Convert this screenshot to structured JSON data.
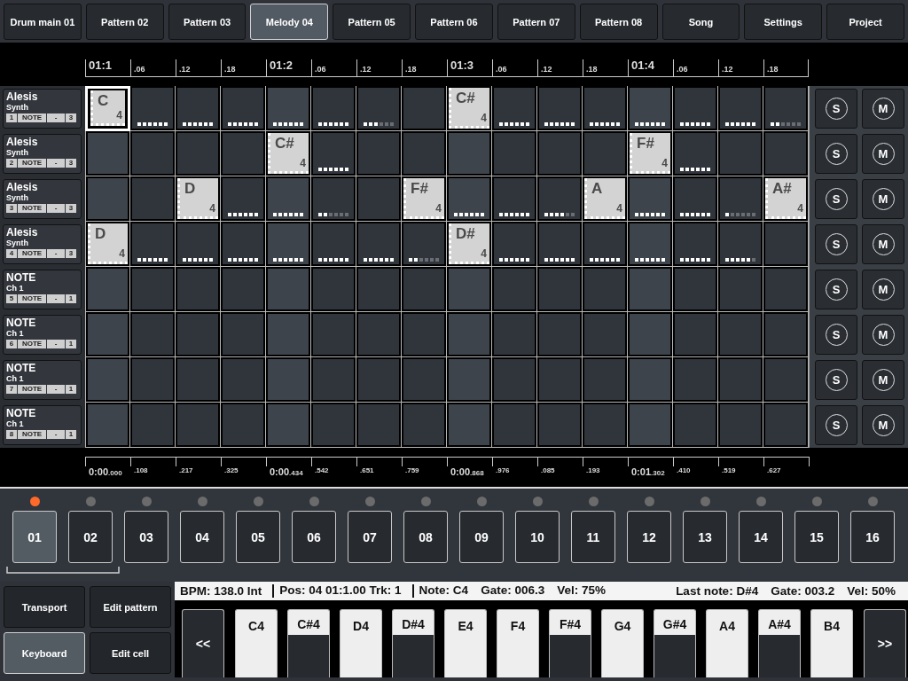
{
  "tabs": [
    {
      "label": "Drum main 01",
      "selected": false
    },
    {
      "label": "Pattern 02",
      "selected": false
    },
    {
      "label": "Pattern 03",
      "selected": false
    },
    {
      "label": "Melody 04",
      "selected": true
    },
    {
      "label": "Pattern 05",
      "selected": false
    },
    {
      "label": "Pattern 06",
      "selected": false
    },
    {
      "label": "Pattern 07",
      "selected": false
    },
    {
      "label": "Pattern 08",
      "selected": false
    },
    {
      "label": "Song",
      "selected": false
    },
    {
      "label": "Settings",
      "selected": false
    },
    {
      "label": "Project",
      "selected": false
    }
  ],
  "top_ruler": [
    {
      "label": "01:1",
      "kind": "major"
    },
    {
      "label": ".06",
      "kind": "minor"
    },
    {
      "label": ".12",
      "kind": "minor"
    },
    {
      "label": ".18",
      "kind": "minor"
    },
    {
      "label": "01:2",
      "kind": "major"
    },
    {
      "label": ".06",
      "kind": "minor"
    },
    {
      "label": ".12",
      "kind": "minor"
    },
    {
      "label": ".18",
      "kind": "minor"
    },
    {
      "label": "01:3",
      "kind": "major"
    },
    {
      "label": ".06",
      "kind": "minor"
    },
    {
      "label": ".12",
      "kind": "minor"
    },
    {
      "label": ".18",
      "kind": "minor"
    },
    {
      "label": "01:4",
      "kind": "major"
    },
    {
      "label": ".06",
      "kind": "minor"
    },
    {
      "label": ".12",
      "kind": "minor"
    },
    {
      "label": ".18",
      "kind": "minor"
    }
  ],
  "tracks": [
    {
      "name": "Alesis",
      "sub": "Synth",
      "number": "1",
      "type": "NOTE",
      "sign": "-",
      "value": "3",
      "solo": "S",
      "mute": "M",
      "cells": [
        {
          "kind": "note",
          "note": "C",
          "octave": "4",
          "selected": true
        },
        {
          "kind": "tail",
          "level": 1,
          "selected": false
        },
        {
          "kind": "tail",
          "level": 1,
          "selected": false
        },
        {
          "kind": "tail",
          "level": 1,
          "selected": false
        },
        {
          "kind": "tail",
          "level": 1,
          "selected": false
        },
        {
          "kind": "tail",
          "level": 1,
          "selected": false
        },
        {
          "kind": "tail",
          "level": 0.5,
          "selected": false
        },
        {
          "kind": "empty",
          "selected": false
        },
        {
          "kind": "note",
          "note": "C#",
          "octave": "4",
          "selected": false
        },
        {
          "kind": "tail",
          "level": 1,
          "selected": false
        },
        {
          "kind": "tail",
          "level": 1,
          "selected": false
        },
        {
          "kind": "tail",
          "level": 1,
          "selected": false
        },
        {
          "kind": "tail",
          "level": 1,
          "selected": false
        },
        {
          "kind": "tail",
          "level": 1,
          "selected": false
        },
        {
          "kind": "tail",
          "level": 1,
          "selected": false
        },
        {
          "kind": "tail",
          "level": 0.33,
          "selected": false
        }
      ]
    },
    {
      "name": "Alesis",
      "sub": "Synth",
      "number": "2",
      "type": "NOTE",
      "sign": "-",
      "value": "3",
      "solo": "S",
      "mute": "M",
      "cells": [
        {
          "kind": "empty",
          "selected": false
        },
        {
          "kind": "empty",
          "selected": false
        },
        {
          "kind": "empty",
          "selected": false
        },
        {
          "kind": "empty",
          "selected": false
        },
        {
          "kind": "note",
          "note": "C#",
          "octave": "4",
          "selected": false
        },
        {
          "kind": "tail",
          "level": 1,
          "selected": false
        },
        {
          "kind": "empty",
          "selected": false
        },
        {
          "kind": "empty",
          "selected": false
        },
        {
          "kind": "empty",
          "selected": false
        },
        {
          "kind": "empty",
          "selected": false
        },
        {
          "kind": "empty",
          "selected": false
        },
        {
          "kind": "empty",
          "selected": false
        },
        {
          "kind": "note",
          "note": "F#",
          "octave": "4",
          "selected": false
        },
        {
          "kind": "tail",
          "level": 1,
          "selected": false
        },
        {
          "kind": "empty",
          "selected": false
        },
        {
          "kind": "empty",
          "selected": false
        }
      ]
    },
    {
      "name": "Alesis",
      "sub": "Synth",
      "number": "3",
      "type": "NOTE",
      "sign": "-",
      "value": "3",
      "solo": "S",
      "mute": "M",
      "cells": [
        {
          "kind": "empty",
          "selected": false
        },
        {
          "kind": "empty",
          "selected": false
        },
        {
          "kind": "note",
          "note": "D",
          "octave": "4",
          "selected": false
        },
        {
          "kind": "tail",
          "level": 1,
          "selected": false
        },
        {
          "kind": "tail",
          "level": 1,
          "selected": false
        },
        {
          "kind": "tail",
          "level": 0.33,
          "selected": false
        },
        {
          "kind": "empty",
          "selected": false
        },
        {
          "kind": "note",
          "note": "F#",
          "octave": "4",
          "selected": false
        },
        {
          "kind": "tail",
          "level": 1,
          "selected": false
        },
        {
          "kind": "tail",
          "level": 1,
          "selected": false
        },
        {
          "kind": "tail",
          "level": 0.67,
          "selected": false
        },
        {
          "kind": "note",
          "note": "A",
          "octave": "4",
          "selected": false
        },
        {
          "kind": "tail",
          "level": 1,
          "selected": false
        },
        {
          "kind": "tail",
          "level": 1,
          "selected": false
        },
        {
          "kind": "tail",
          "level": 0.17,
          "selected": false
        },
        {
          "kind": "note",
          "note": "A#",
          "octave": "4",
          "selected": false
        }
      ]
    },
    {
      "name": "Alesis",
      "sub": "Synth",
      "number": "4",
      "type": "NOTE",
      "sign": "-",
      "value": "3",
      "solo": "S",
      "mute": "M",
      "cells": [
        {
          "kind": "note",
          "note": "D",
          "octave": "4",
          "selected": false
        },
        {
          "kind": "tail",
          "level": 1,
          "selected": false
        },
        {
          "kind": "tail",
          "level": 1,
          "selected": false
        },
        {
          "kind": "tail",
          "level": 1,
          "selected": false
        },
        {
          "kind": "tail",
          "level": 1,
          "selected": false
        },
        {
          "kind": "tail",
          "level": 1,
          "selected": false
        },
        {
          "kind": "tail",
          "level": 1,
          "selected": false
        },
        {
          "kind": "tail",
          "level": 0.33,
          "selected": false
        },
        {
          "kind": "note",
          "note": "D#",
          "octave": "4",
          "selected": false
        },
        {
          "kind": "tail",
          "level": 1,
          "selected": false
        },
        {
          "kind": "tail",
          "level": 1,
          "selected": false
        },
        {
          "kind": "tail",
          "level": 1,
          "selected": false
        },
        {
          "kind": "tail",
          "level": 1,
          "selected": false
        },
        {
          "kind": "tail",
          "level": 1,
          "selected": false
        },
        {
          "kind": "tail",
          "level": 0.83,
          "selected": false
        },
        {
          "kind": "empty",
          "selected": false
        }
      ]
    },
    {
      "name": "NOTE",
      "sub": "Ch 1",
      "number": "5",
      "type": "NOTE",
      "sign": "-",
      "value": "1",
      "solo": "S",
      "mute": "M",
      "cells": [
        {
          "kind": "empty",
          "selected": false
        },
        {
          "kind": "empty",
          "selected": false
        },
        {
          "kind": "empty",
          "selected": false
        },
        {
          "kind": "empty",
          "selected": false
        },
        {
          "kind": "empty",
          "selected": false
        },
        {
          "kind": "empty",
          "selected": false
        },
        {
          "kind": "empty",
          "selected": false
        },
        {
          "kind": "empty",
          "selected": false
        },
        {
          "kind": "empty",
          "selected": false
        },
        {
          "kind": "empty",
          "selected": false
        },
        {
          "kind": "empty",
          "selected": false
        },
        {
          "kind": "empty",
          "selected": false
        },
        {
          "kind": "empty",
          "selected": false
        },
        {
          "kind": "empty",
          "selected": false
        },
        {
          "kind": "empty",
          "selected": false
        },
        {
          "kind": "empty",
          "selected": false
        }
      ]
    },
    {
      "name": "NOTE",
      "sub": "Ch 1",
      "number": "6",
      "type": "NOTE",
      "sign": "-",
      "value": "1",
      "solo": "S",
      "mute": "M",
      "cells": [
        {
          "kind": "empty",
          "selected": false
        },
        {
          "kind": "empty",
          "selected": false
        },
        {
          "kind": "empty",
          "selected": false
        },
        {
          "kind": "empty",
          "selected": false
        },
        {
          "kind": "empty",
          "selected": false
        },
        {
          "kind": "empty",
          "selected": false
        },
        {
          "kind": "empty",
          "selected": false
        },
        {
          "kind": "empty",
          "selected": false
        },
        {
          "kind": "empty",
          "selected": false
        },
        {
          "kind": "empty",
          "selected": false
        },
        {
          "kind": "empty",
          "selected": false
        },
        {
          "kind": "empty",
          "selected": false
        },
        {
          "kind": "empty",
          "selected": false
        },
        {
          "kind": "empty",
          "selected": false
        },
        {
          "kind": "empty",
          "selected": false
        },
        {
          "kind": "empty",
          "selected": false
        }
      ]
    },
    {
      "name": "NOTE",
      "sub": "Ch 1",
      "number": "7",
      "type": "NOTE",
      "sign": "-",
      "value": "1",
      "solo": "S",
      "mute": "M",
      "cells": [
        {
          "kind": "empty",
          "selected": false
        },
        {
          "kind": "empty",
          "selected": false
        },
        {
          "kind": "empty",
          "selected": false
        },
        {
          "kind": "empty",
          "selected": false
        },
        {
          "kind": "empty",
          "selected": false
        },
        {
          "kind": "empty",
          "selected": false
        },
        {
          "kind": "empty",
          "selected": false
        },
        {
          "kind": "empty",
          "selected": false
        },
        {
          "kind": "empty",
          "selected": false
        },
        {
          "kind": "empty",
          "selected": false
        },
        {
          "kind": "empty",
          "selected": false
        },
        {
          "kind": "empty",
          "selected": false
        },
        {
          "kind": "empty",
          "selected": false
        },
        {
          "kind": "empty",
          "selected": false
        },
        {
          "kind": "empty",
          "selected": false
        },
        {
          "kind": "empty",
          "selected": false
        }
      ]
    },
    {
      "name": "NOTE",
      "sub": "Ch 1",
      "number": "8",
      "type": "NOTE",
      "sign": "-",
      "value": "1",
      "solo": "S",
      "mute": "M",
      "cells": [
        {
          "kind": "empty",
          "selected": false
        },
        {
          "kind": "empty",
          "selected": false
        },
        {
          "kind": "empty",
          "selected": false
        },
        {
          "kind": "empty",
          "selected": false
        },
        {
          "kind": "empty",
          "selected": false
        },
        {
          "kind": "empty",
          "selected": false
        },
        {
          "kind": "empty",
          "selected": false
        },
        {
          "kind": "empty",
          "selected": false
        },
        {
          "kind": "empty",
          "selected": false
        },
        {
          "kind": "empty",
          "selected": false
        },
        {
          "kind": "empty",
          "selected": false
        },
        {
          "kind": "empty",
          "selected": false
        },
        {
          "kind": "empty",
          "selected": false
        },
        {
          "kind": "empty",
          "selected": false
        },
        {
          "kind": "empty",
          "selected": false
        },
        {
          "kind": "empty",
          "selected": false
        }
      ]
    }
  ],
  "time_ruler": [
    {
      "main": "0:00",
      "fraction": ".000"
    },
    {
      "fraction": ".108"
    },
    {
      "fraction": ".217"
    },
    {
      "fraction": ".325"
    },
    {
      "main": "0:00",
      "fraction": ".434"
    },
    {
      "fraction": ".542"
    },
    {
      "fraction": ".651"
    },
    {
      "fraction": ".759"
    },
    {
      "main": "0:00",
      "fraction": ".868"
    },
    {
      "fraction": ".976"
    },
    {
      "fraction": ".085"
    },
    {
      "fraction": ".193"
    },
    {
      "main": "0:01",
      "fraction": ".302"
    },
    {
      "fraction": ".410"
    },
    {
      "fraction": ".519"
    },
    {
      "fraction": ".627"
    }
  ],
  "steps": [
    {
      "label": "01",
      "selected": true,
      "color": "#ff6a2a"
    },
    {
      "label": "02",
      "selected": false,
      "color": "#6b6b6b"
    },
    {
      "label": "03",
      "selected": false,
      "color": "#6b6b6b"
    },
    {
      "label": "04",
      "selected": false,
      "color": "#6b6b6b"
    },
    {
      "label": "05",
      "selected": false,
      "color": "#6b6b6b"
    },
    {
      "label": "06",
      "selected": false,
      "color": "#6b6b6b"
    },
    {
      "label": "07",
      "selected": false,
      "color": "#6b6b6b"
    },
    {
      "label": "08",
      "selected": false,
      "color": "#6b6b6b"
    },
    {
      "label": "09",
      "selected": false,
      "color": "#6b6b6b"
    },
    {
      "label": "10",
      "selected": false,
      "color": "#6b6b6b"
    },
    {
      "label": "11",
      "selected": false,
      "color": "#6b6b6b"
    },
    {
      "label": "12",
      "selected": false,
      "color": "#6b6b6b"
    },
    {
      "label": "13",
      "selected": false,
      "color": "#6b6b6b"
    },
    {
      "label": "14",
      "selected": false,
      "color": "#6b6b6b"
    },
    {
      "label": "15",
      "selected": false,
      "color": "#6b6b6b"
    },
    {
      "label": "16",
      "selected": false,
      "color": "#6b6b6b"
    }
  ],
  "modes": [
    {
      "label": "Transport",
      "selected": false
    },
    {
      "label": "Edit pattern",
      "selected": false
    },
    {
      "label": "Keyboard",
      "selected": true
    },
    {
      "label": "Edit cell",
      "selected": false
    }
  ],
  "status_bar": {
    "left": [
      [
        "BPM: 138.0 Int"
      ],
      [
        "Pos: 04 01:1.00 Trk: 1"
      ],
      [
        "Note: C4",
        "Gate: 006.3",
        "Vel: 75%"
      ]
    ],
    "right": [
      "Last note: D#4",
      "Gate: 003.2",
      "Vel: 50%"
    ]
  },
  "keyboard": {
    "prev": "<<",
    "next": ">>",
    "keys": [
      {
        "label": "C4",
        "kind": "white"
      },
      {
        "label": "C#4",
        "kind": "black"
      },
      {
        "label": "D4",
        "kind": "white"
      },
      {
        "label": "D#4",
        "kind": "black"
      },
      {
        "label": "E4",
        "kind": "white"
      },
      {
        "label": "F4",
        "kind": "white"
      },
      {
        "label": "F#4",
        "kind": "black"
      },
      {
        "label": "G4",
        "kind": "white"
      },
      {
        "label": "G#4",
        "kind": "black"
      },
      {
        "label": "A4",
        "kind": "white"
      },
      {
        "label": "A#4",
        "kind": "black"
      },
      {
        "label": "B4",
        "kind": "white"
      }
    ]
  }
}
